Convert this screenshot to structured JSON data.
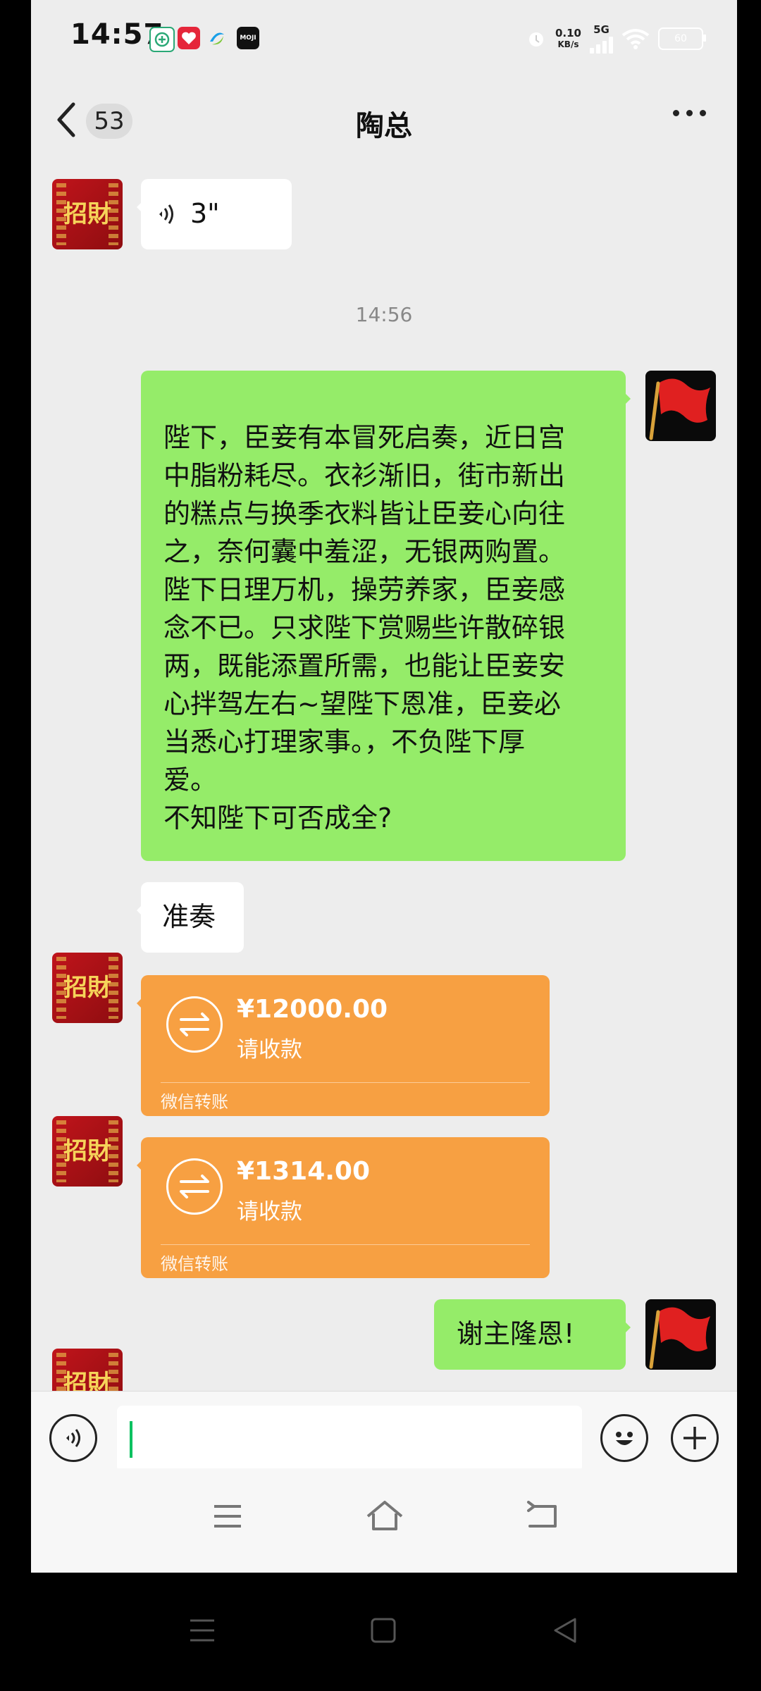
{
  "status_bar": {
    "time": "14:57",
    "net_speed_value": "0.10",
    "net_speed_unit": "KB/s",
    "network": "5G",
    "battery": "60",
    "app_icons": [
      "hospital-app-icon",
      "red-heart-app-icon",
      "china-mobile-app-icon",
      "moji-weather-app-icon"
    ],
    "moji_label": "MOJI"
  },
  "header": {
    "back_label": "<",
    "unread_count": "53",
    "title": "陶总",
    "more_icon": "more-dots-icon"
  },
  "avatars": {
    "contact_text": "招財",
    "self_icon": "red-flag-icon"
  },
  "messages": [
    {
      "type": "voice",
      "sender": "contact",
      "duration": "3\""
    },
    {
      "type": "timestamp",
      "text": "14:56"
    },
    {
      "type": "text",
      "sender": "self",
      "lines": [
        "陛下，臣妾有本冒死启奏，近日宫",
        "中脂粉耗尽。衣衫渐旧，街市新出",
        "的糕点与换季衣料皆让臣妾心向往",
        "之，奈何囊中羞涩，无银两购置。",
        "陛下日理万机，操劳养家，臣妾感",
        "念不已。只求陛下赏赐些许散碎银",
        "两，既能添置所需，也能让臣妾安",
        "心拌驾左右~望陛下恩准，臣妾必",
        "当悉心打理家事。，不负陛下厚",
        "爱。",
        "不知陛下可否成全?"
      ]
    },
    {
      "type": "text",
      "sender": "contact",
      "text": "准奏"
    },
    {
      "type": "transfer",
      "sender": "contact",
      "amount": "¥12000.00",
      "status": "请收款",
      "label": "微信转账"
    },
    {
      "type": "transfer",
      "sender": "contact",
      "amount": "¥1314.00",
      "status": "请收款",
      "label": "微信转账"
    },
    {
      "type": "text",
      "sender": "self",
      "text": "谢主隆恩!"
    }
  ],
  "input_bar": {
    "value": "",
    "placeholder": ""
  },
  "colors": {
    "chat_background": "#ededed",
    "self_bubble": "#95ec69",
    "contact_bubble": "#ffffff",
    "transfer_bubble": "#f7a042",
    "caret": "#07c160"
  }
}
